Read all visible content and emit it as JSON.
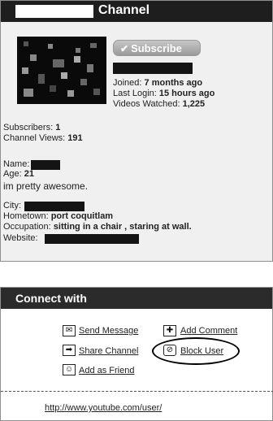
{
  "channel": {
    "title": "Channel",
    "subscribe_label": "Subscribe",
    "joined_label": "Joined:",
    "joined_value": "7 months ago",
    "last_login_label": "Last Login:",
    "last_login_value": "15 hours ago",
    "videos_watched_label": "Videos Watched:",
    "videos_watched_value": "1,225",
    "subscribers_label": "Subscribers:",
    "subscribers_value": "1",
    "channel_views_label": "Channel Views:",
    "channel_views_value": "191",
    "name_label": "Name:",
    "age_label": "Age:",
    "age_value": "21",
    "about": "im pretty awesome.",
    "city_label": "City:",
    "hometown_label": "Hometown:",
    "hometown_value": "port coquitlam",
    "occupation_label": "Occupation:",
    "occupation_value": "sitting in a chair , staring at wall.",
    "website_label": "Website:"
  },
  "connect": {
    "title": "Connect with",
    "send_message": "Send Message",
    "add_comment": "Add Comment",
    "share_channel": "Share Channel",
    "block_user": "Block User",
    "add_friend": "Add as Friend",
    "url": "http://www.youtube.com/user/"
  },
  "icons": {
    "subscribe": "checkmark-icon",
    "send_message": "envelope-icon",
    "add_comment": "plus-comment-icon",
    "share_channel": "arrow-right-icon",
    "block_user": "block-icon",
    "add_friend": "add-friend-icon"
  }
}
